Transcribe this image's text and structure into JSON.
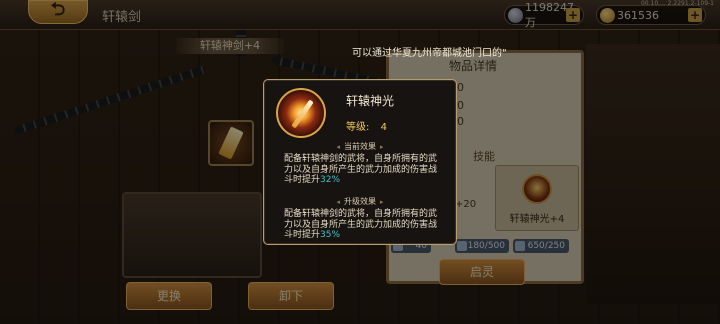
{
  "header": {
    "back_icon": "back-arrow-icon",
    "title": "轩辕剑",
    "silver": "1198247万",
    "gold": "361536",
    "version": "00.10.... 2.2291.2-109-1"
  },
  "scene": {
    "weapon_name": "轩辕神剑+4",
    "marquee": "可以通过华夏九州帝都城池门口的\"",
    "buttons": {
      "change": "更换",
      "unload": "卸下"
    }
  },
  "detail_panel": {
    "title": "物品详情",
    "values": [
      "0",
      "0",
      "0"
    ],
    "skill_header": "技能",
    "skill_card_label": "轩辕神光+4",
    "percent_left": "+20",
    "stats": [
      "180/500",
      "650/250"
    ],
    "partial_stat": "40",
    "awaken_label": "启灵"
  },
  "popup": {
    "skill_name": "轩辕神光",
    "level_label": "等级:",
    "level_value": "4",
    "current_header": "当前效果",
    "current_text": "配备轩辕神剑的武将，自身所拥有的武力以及自身所产生的武力加成的伤害战斗时提升",
    "current_pct": "32%",
    "upgrade_header": "升级效果",
    "upgrade_text": "配备轩辕神剑的武将，自身所拥有的武力以及自身所产生的武力加成的伤害战斗时提升",
    "upgrade_pct": "35%"
  }
}
